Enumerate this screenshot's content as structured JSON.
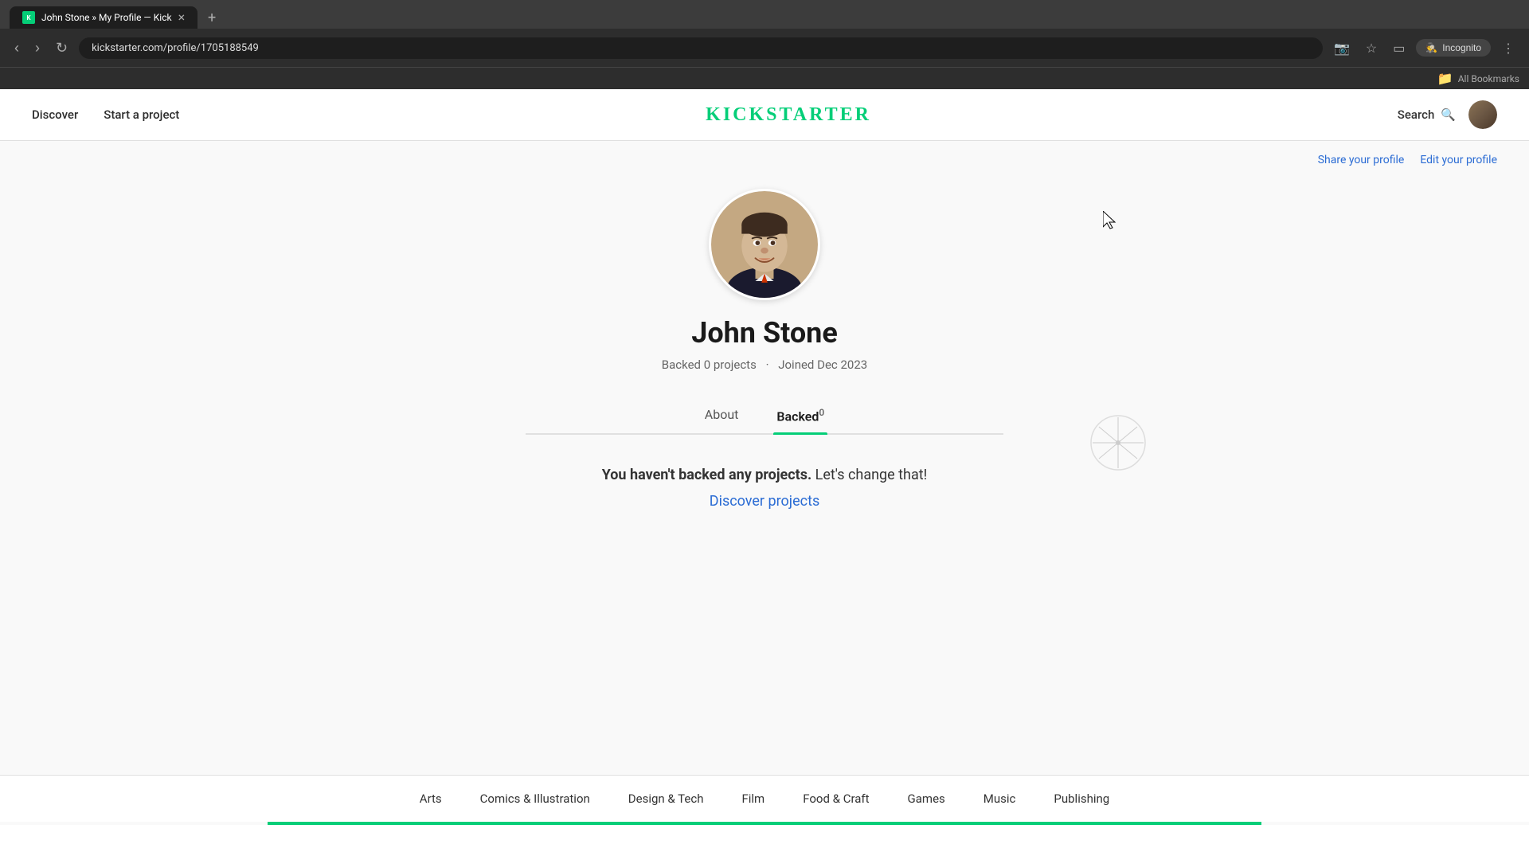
{
  "browser": {
    "tab_title": "John Stone » My Profile — Kick",
    "url": "kickstarter.com/profile/1705188549",
    "new_tab_label": "+",
    "back_label": "‹",
    "forward_label": "›",
    "reload_label": "↻",
    "incognito_label": "Incognito",
    "bookmarks_label": "All Bookmarks"
  },
  "header": {
    "nav_discover": "Discover",
    "nav_start": "Start a project",
    "logo": "KICKSTARTER",
    "search_label": "Search",
    "profile_actions": {
      "share": "Share your profile",
      "edit": "Edit your profile"
    }
  },
  "profile": {
    "name": "John Stone",
    "meta": "Backed 0 projects · Joined Dec 2023",
    "backed_count": "0 projects",
    "joined": "Joined Dec 2023",
    "tabs": {
      "about": "About",
      "backed": "Backed",
      "backed_count": "0"
    },
    "empty_state": {
      "bold_text": "You haven't backed any projects.",
      "normal_text": " Let's change that!",
      "discover_link": "Discover projects"
    }
  },
  "footer": {
    "categories": [
      "Arts",
      "Comics & Illustration",
      "Design & Tech",
      "Film",
      "Food & Craft",
      "Games",
      "Music",
      "Publishing"
    ]
  }
}
